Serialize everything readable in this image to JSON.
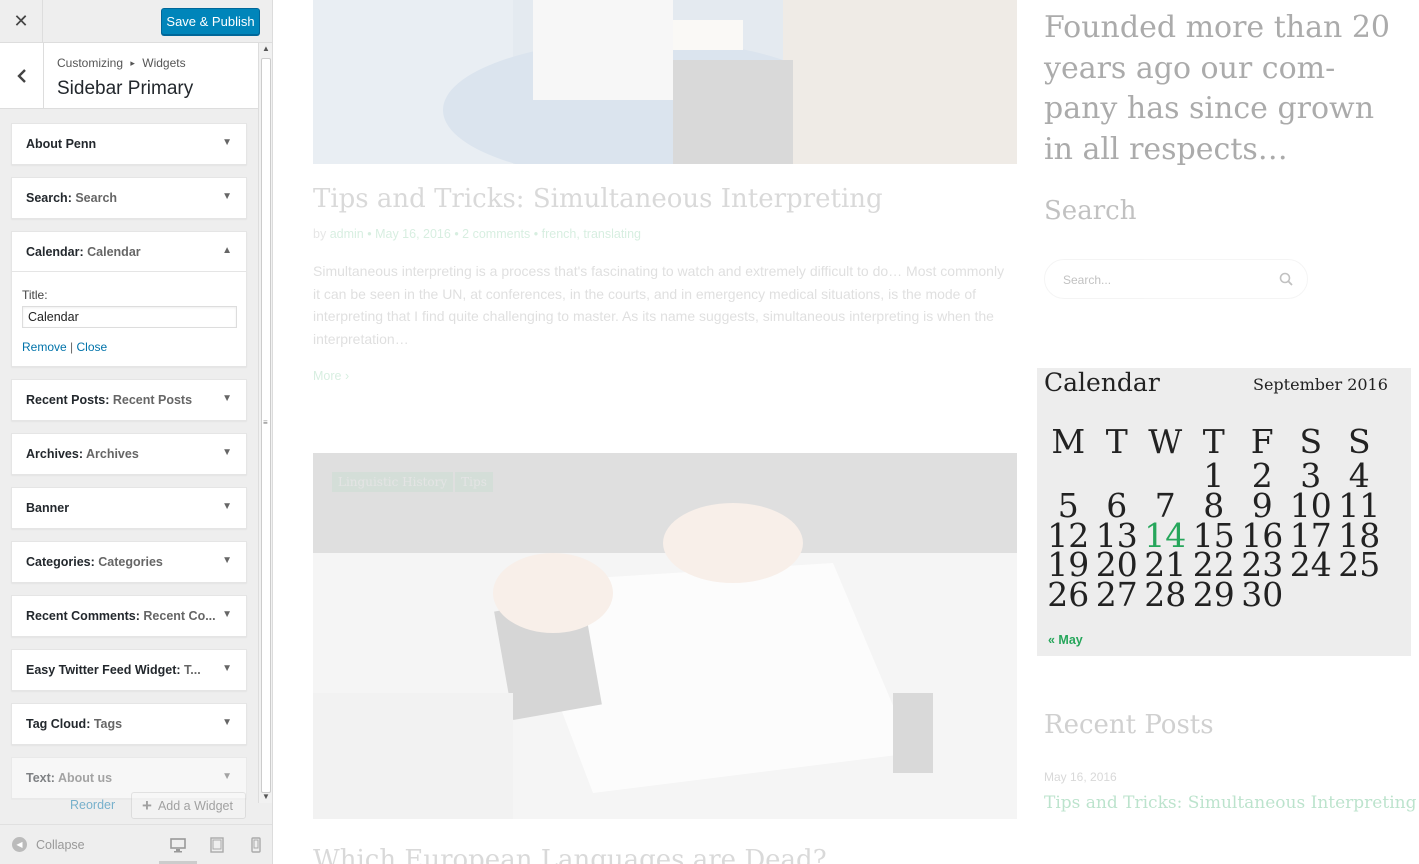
{
  "topbar": {
    "close_glyph": "✕",
    "save_label": "Save & Publish"
  },
  "section": {
    "back_glyph": "‹",
    "breadcrumb_root": "Customizing",
    "breadcrumb_arrow": "▸",
    "breadcrumb_leaf": "Widgets",
    "title": "Sidebar Primary"
  },
  "widgets": [
    {
      "title": "About Penn",
      "sub": ""
    },
    {
      "title": "Search",
      "sub": "Search"
    },
    {
      "title": "Calendar",
      "sub": "Calendar"
    },
    {
      "title": "Recent Posts",
      "sub": "Recent Posts"
    },
    {
      "title": "Archives",
      "sub": "Archives"
    },
    {
      "title": "Banner",
      "sub": ""
    },
    {
      "title": "Categories",
      "sub": "Categories"
    },
    {
      "title": "Recent Comments",
      "sub": "Recent Co..."
    },
    {
      "title": "Easy Twitter Feed Widget",
      "sub": "T..."
    },
    {
      "title": "Tag Cloud",
      "sub": "Tags"
    },
    {
      "title": "Text",
      "sub": "About us"
    }
  ],
  "calendar_widget_form": {
    "title_label": "Title:",
    "title_value": "Calendar",
    "remove_label": "Remove",
    "separator": "|",
    "close_label": "Close"
  },
  "actions": {
    "reorder_label": "Reorder",
    "add_widget_label": "Add a Widget",
    "add_glyph": "+"
  },
  "footer": {
    "collapse_label": "Collapse"
  },
  "preview": {
    "post1": {
      "title": "Tips and Tricks: Simultaneous Interpreting",
      "meta_by": "by",
      "author": "admin",
      "date": "May 16, 2016",
      "comments": "2 comments",
      "cat1": "french",
      "cat2": "translating",
      "excerpt": "Simultaneous interpreting is a process that's fascinating to watch and extremely difficult to do… Most commonly it can be seen in the UN, at conferences, in the courts, and in emergency medical situations, is the mode of interpreting that I find quite challenging to master. As its name suggests, simultaneous interpreting is when the interpretation…",
      "more": "More ›"
    },
    "post2": {
      "tag1": "Linguistic History",
      "tag2": "Tips",
      "title": "Which European Languages are Dead?"
    },
    "about_quote": "Founded more than 20 years ago our com-pany has since grown in all respects…",
    "search_heading": "Search",
    "search_placeholder": "Search...",
    "calendar": {
      "title": "Calendar",
      "caption": "September 2016",
      "weekdays": [
        "M",
        "T",
        "W",
        "T",
        "F",
        "S",
        "S"
      ],
      "weeks": [
        [
          "",
          "",
          "",
          "1",
          "2",
          "3",
          "4"
        ],
        [
          "5",
          "6",
          "7",
          "8",
          "9",
          "10",
          "11"
        ],
        [
          "12",
          "13",
          "14",
          "15",
          "16",
          "17",
          "18"
        ],
        [
          "19",
          "20",
          "21",
          "22",
          "23",
          "24",
          "25"
        ],
        [
          "26",
          "27",
          "28",
          "29",
          "30",
          "",
          ""
        ]
      ],
      "today": "14",
      "prev": "« May"
    },
    "recent_heading": "Recent Posts",
    "recent_date": "May 16, 2016",
    "recent_link": "Tips and Tricks: Simultaneous Interpreting"
  },
  "colors": {
    "primary_button": "#0085ba",
    "link": "#0073aa",
    "accent_green": "#26a65b"
  }
}
